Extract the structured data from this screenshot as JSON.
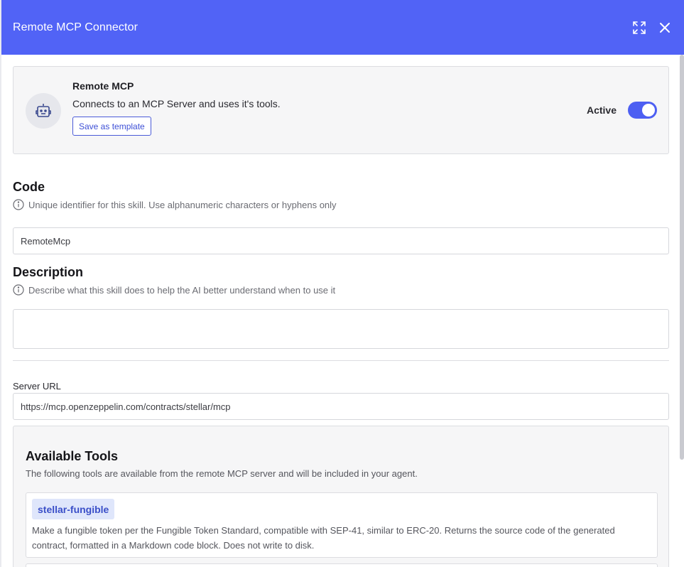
{
  "window": {
    "title": "Remote MCP Connector",
    "expand_icon": "expand-icon",
    "close_icon": "close-icon"
  },
  "skill": {
    "name": "Remote MCP",
    "description": "Connects to an MCP Server and uses it's tools.",
    "template_button": "Save as template",
    "active_label": "Active",
    "active": true,
    "icon": "robot-icon"
  },
  "code": {
    "title": "Code",
    "help": "Unique identifier for this skill. Use alphanumeric characters or hyphens only",
    "value": "RemoteMcp"
  },
  "description": {
    "title": "Description",
    "help": "Describe what this skill does to help the AI better understand when to use it",
    "value": ""
  },
  "server_url": {
    "label": "Server URL",
    "value": "https://mcp.openzeppelin.com/contracts/stellar/mcp"
  },
  "tools": {
    "title": "Available Tools",
    "subtitle": "The following tools are available from the remote MCP server and will be included in your agent.",
    "items": [
      {
        "name": "stellar-fungible",
        "description": "Make a fungible token per the Fungible Token Standard, compatible with SEP-41, similar to ERC-20. Returns the source code of the generated contract, formatted in a Markdown code block. Does not write to disk."
      }
    ]
  },
  "colors": {
    "header": "#5163f6",
    "accent": "#4d5ff2",
    "badge_bg": "#dfe6fb"
  }
}
